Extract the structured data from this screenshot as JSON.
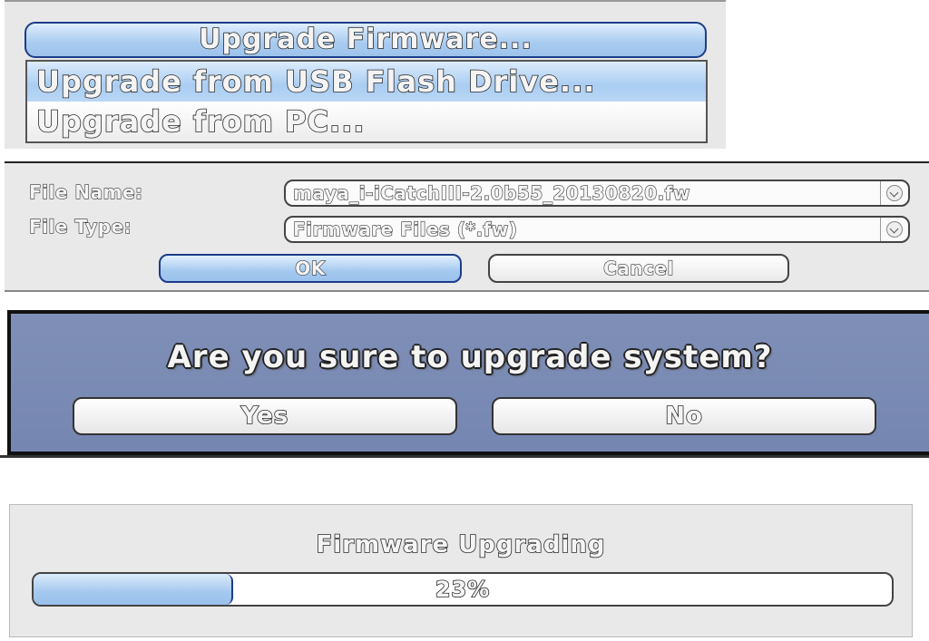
{
  "upgrade_menu": {
    "title": "Upgrade Firmware...",
    "items": [
      {
        "label": "Upgrade from USB Flash Drive...",
        "selected": true
      },
      {
        "label": "Upgrade from PC...",
        "selected": false
      }
    ]
  },
  "file_dialog": {
    "file_name_label": "File Name:",
    "file_name_value": "maya_i-iCatchIII-2.0b55_20130820.fw",
    "file_type_label": "File Type:",
    "file_type_value": "Firmware Files (*.fw)",
    "ok_label": "OK",
    "cancel_label": "Cancel"
  },
  "confirm_dialog": {
    "message": "Are you sure to upgrade system?",
    "yes_label": "Yes",
    "no_label": "No"
  },
  "progress": {
    "title": "Firmware Upgrading",
    "percent_text": "23%",
    "fraction": 0.23
  },
  "colors": {
    "accent_blue": "#a8cbf0",
    "dialog_blue": "#7a8bb4",
    "border_blue": "#1d3c8a"
  }
}
